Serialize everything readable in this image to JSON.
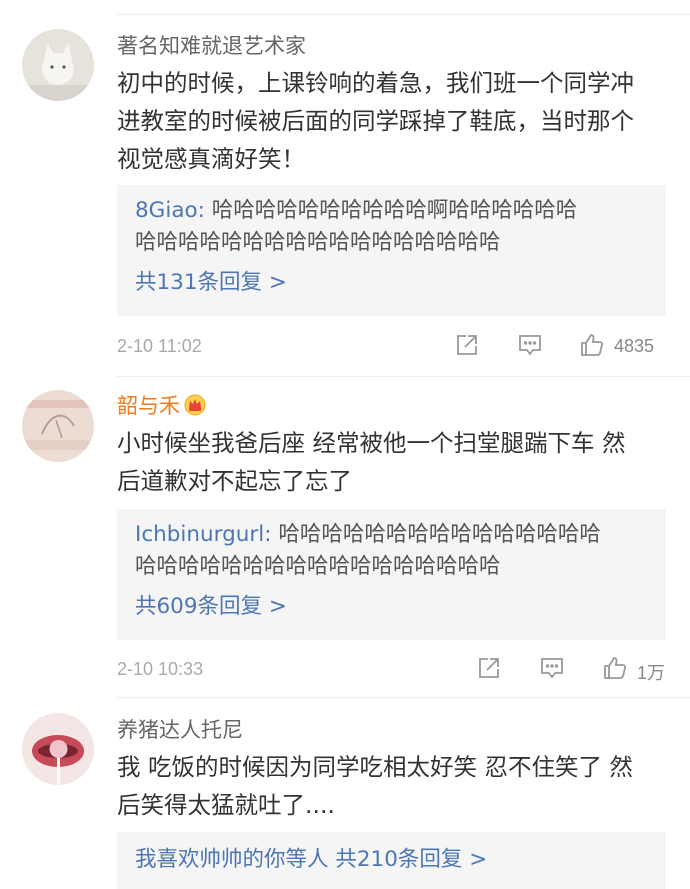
{
  "comments": [
    {
      "username": "著名知难就退艺术家",
      "text_lines": [
        "初中的时候，上课铃响的着急，我们班一个同学冲",
        "进教室的时候被后面的同学踩掉了鞋底，当时那个",
        "视觉感真滴好笑！"
      ],
      "reply": {
        "user": "8Giao:",
        "lines": [
          "哈哈哈哈哈哈哈哈哈哈啊哈哈哈哈哈哈",
          "哈哈哈哈哈哈哈哈哈哈哈哈哈哈哈哈哈"
        ],
        "more": "共131条回复 >"
      },
      "time": "2-10 11:02",
      "likes": "4835"
    },
    {
      "username": "韶与禾",
      "text_lines": [
        "小时候坐我爸后座 经常被他一个扫堂腿踹下车 然",
        "后道歉对不起忘了忘了"
      ],
      "reply": {
        "user": "Ichbinurgurl:",
        "lines": [
          "哈哈哈哈哈哈哈哈哈哈哈哈哈哈哈",
          "哈哈哈哈哈哈哈哈哈哈哈哈哈哈哈哈哈"
        ],
        "more": "共609条回复 >"
      },
      "time": "2-10 10:33",
      "likes": "1万"
    },
    {
      "username": "养猪达人托尼",
      "text_lines": [
        "我 吃饭的时候因为同学吃相太好笑 忍不住笑了 然",
        "后笑得太猛就吐了...."
      ],
      "reply": {
        "user": "我喜欢帅帅的你等人",
        "more": "共210条回复 >"
      }
    }
  ],
  "colors": {
    "link": "#4c76b4",
    "vip_name": "#f27a1a",
    "reply_bg": "#f5f5f5",
    "meta": "#aaaaaa"
  },
  "icons": {
    "share": "share-icon",
    "comment": "comment-icon",
    "like": "thumbs-up-icon",
    "badge": "crown-badge-icon"
  }
}
